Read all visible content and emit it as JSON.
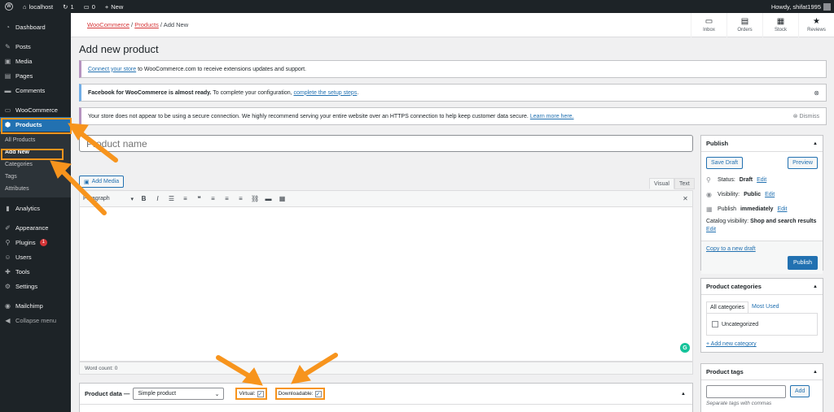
{
  "adminbar": {
    "site": "localhost",
    "updates": "1",
    "comments": "0",
    "new": "New",
    "howdy": "Howdy, shifat1995"
  },
  "sidebar": {
    "items": [
      {
        "label": "Dashboard",
        "icon": "dashboard-icon"
      },
      {
        "label": "Posts",
        "icon": "pin-icon"
      },
      {
        "label": "Media",
        "icon": "media-icon"
      },
      {
        "label": "Pages",
        "icon": "pages-icon"
      },
      {
        "label": "Comments",
        "icon": "comment-icon"
      },
      {
        "label": "WooCommerce",
        "icon": "woo-icon"
      },
      {
        "label": "Products",
        "icon": "products-icon"
      }
    ],
    "submenu": [
      "All Products",
      "Add New",
      "Categories",
      "Tags",
      "Attributes"
    ],
    "items2": [
      {
        "label": "Analytics",
        "icon": "analytics-icon"
      },
      {
        "label": "Appearance",
        "icon": "brush-icon"
      },
      {
        "label": "Plugins",
        "icon": "plugin-icon",
        "badge": "1"
      },
      {
        "label": "Users",
        "icon": "users-icon"
      },
      {
        "label": "Tools",
        "icon": "tools-icon"
      },
      {
        "label": "Settings",
        "icon": "settings-icon"
      },
      {
        "label": "Mailchimp",
        "icon": "mailchimp-icon"
      },
      {
        "label": "Collapse menu",
        "icon": "collapse-icon"
      }
    ]
  },
  "header": {
    "breadcrumb": [
      "WooCommerce",
      "Products",
      "Add New"
    ],
    "actions": [
      "Inbox",
      "Orders",
      "Stock",
      "Reviews"
    ]
  },
  "main": {
    "title": "Add new product",
    "notice1_link": "Connect your store",
    "notice1_text": " to WooCommerce.com to receive extensions updates and support.",
    "notice2_bold": "Facebook for WooCommerce is almost ready.",
    "notice2_text": " To complete your configuration, ",
    "notice2_link": "complete the setup steps",
    "notice3_text": "Your store does not appear to be using a secure connection. We highly recommend serving your entire website over an HTTPS connection to help keep customer data secure. ",
    "notice3_link": "Learn more here.",
    "dismiss": "Dismiss",
    "product_name_placeholder": "Product name",
    "add_media": "Add Media",
    "tab_visual": "Visual",
    "tab_text": "Text",
    "paragraph": "Paragraph",
    "word_count": "Word count: 0"
  },
  "product_data": {
    "label": "Product data —",
    "type": "Simple product",
    "virtual_label": "Virtual:",
    "downloadable_label": "Downloadable:"
  },
  "publish": {
    "title": "Publish",
    "save_draft": "Save Draft",
    "preview": "Preview",
    "status_label": "Status:",
    "status_value": "Draft",
    "visibility_label": "Visibility:",
    "visibility_value": "Public",
    "publish_label": "Publish",
    "publish_value": "immediately",
    "catalog_label": "Catalog visibility:",
    "catalog_value": "Shop and search results",
    "edit": "Edit",
    "copy_draft": "Copy to a new draft",
    "publish_button": "Publish"
  },
  "categories": {
    "title": "Product categories",
    "tab_all": "All categories",
    "tab_used": "Most Used",
    "item": "Uncategorized",
    "add_new": "+ Add new category"
  },
  "tags": {
    "title": "Product tags",
    "add": "Add",
    "hint": "Separate tags with commas"
  },
  "colors": {
    "accent": "#2271b1",
    "highlight": "#f7941d",
    "woo": "#d63638"
  }
}
